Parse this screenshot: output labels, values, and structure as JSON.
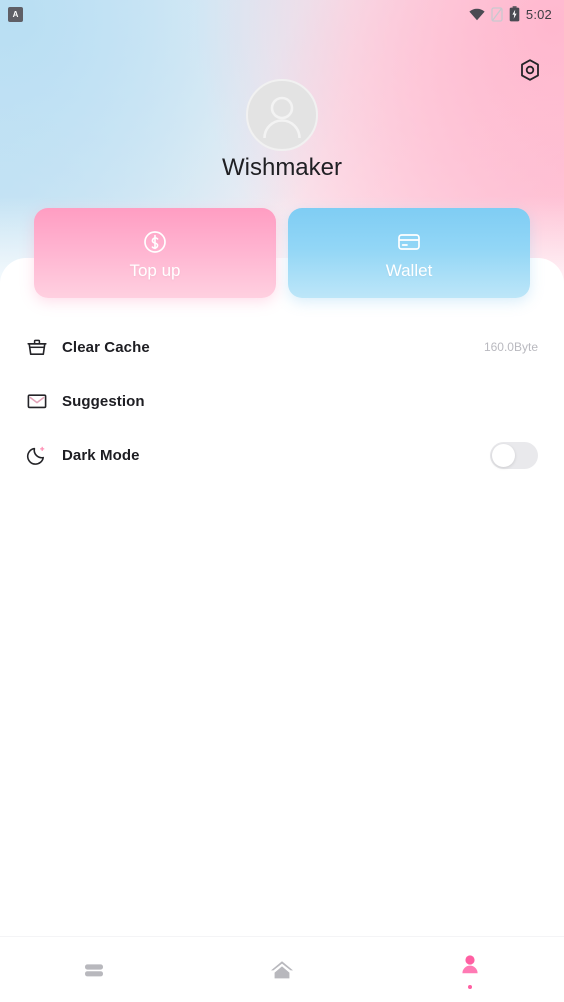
{
  "status_bar": {
    "app_badge": "A",
    "time": "5:02",
    "icons": [
      "wifi-icon",
      "signal-off-icon",
      "battery-charging-icon"
    ]
  },
  "header": {
    "settings_icon": "gear-hexagon-icon",
    "avatar_icon": "person-avatar-icon",
    "profile_name": "Wishmaker"
  },
  "cards": [
    {
      "id": "topup",
      "label": "Top up",
      "icon": "dollar-circle-icon",
      "color": "#ff9dc2"
    },
    {
      "id": "wallet",
      "label": "Wallet",
      "icon": "credit-card-icon",
      "color": "#7fcdf4"
    }
  ],
  "settings": [
    {
      "id": "clear-cache",
      "label": "Clear Cache",
      "icon": "basket-icon",
      "value": "160.0Byte",
      "control": "value"
    },
    {
      "id": "suggestion",
      "label": "Suggestion",
      "icon": "envelope-icon",
      "value": "",
      "control": "none"
    },
    {
      "id": "dark-mode",
      "label": "Dark Mode",
      "icon": "moon-icon",
      "value": "",
      "control": "toggle",
      "toggle_on": false
    }
  ],
  "bottom_nav": [
    {
      "id": "library",
      "icon": "books-icon",
      "active": false
    },
    {
      "id": "home",
      "icon": "home-icon",
      "active": false
    },
    {
      "id": "profile",
      "icon": "person-icon",
      "active": true
    }
  ],
  "colors": {
    "accent_pink": "#ff5fa2",
    "accent_blue": "#7fcdf4",
    "nav_inactive": "#b8b8bd",
    "text_primary": "#1d1d22",
    "text_muted": "#b9b9bf"
  }
}
